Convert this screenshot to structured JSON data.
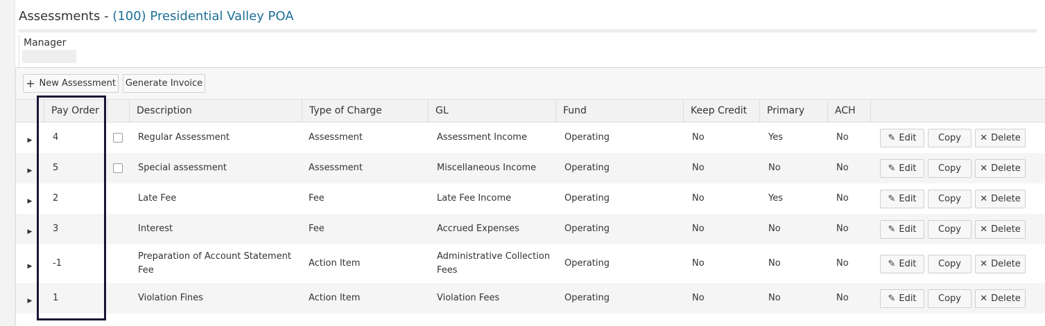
{
  "page": {
    "title_prefix": "Assessments - ",
    "association": "(100) Presidential Valley POA"
  },
  "manager": {
    "label": "Manager",
    "value": ""
  },
  "toolbar": {
    "new_assessment_label": "New Assessment",
    "generate_invoice_label": "Generate Invoice"
  },
  "table": {
    "columns": [
      "Pay Order",
      "Description",
      "Type of Charge",
      "GL",
      "Fund",
      "Keep Credit",
      "Primary",
      "ACH"
    ],
    "rows": [
      {
        "pay_order": "4",
        "has_checkbox": true,
        "description": "Regular Assessment",
        "type": "Assessment",
        "gl": "Assessment Income",
        "fund": "Operating",
        "keep_credit": "No",
        "primary": "Yes",
        "ach": "No"
      },
      {
        "pay_order": "5",
        "has_checkbox": true,
        "description": "Special assessment",
        "type": "Assessment",
        "gl": "Miscellaneous Income",
        "fund": "Operating",
        "keep_credit": "No",
        "primary": "No",
        "ach": "No"
      },
      {
        "pay_order": "2",
        "has_checkbox": false,
        "description": "Late Fee",
        "type": "Fee",
        "gl": "Late Fee Income",
        "fund": "Operating",
        "keep_credit": "No",
        "primary": "Yes",
        "ach": "No"
      },
      {
        "pay_order": "3",
        "has_checkbox": false,
        "description": "Interest",
        "type": "Fee",
        "gl": "Accrued Expenses",
        "fund": "Operating",
        "keep_credit": "No",
        "primary": "No",
        "ach": "No"
      },
      {
        "pay_order": "-1",
        "has_checkbox": false,
        "description": "Preparation of Account Statement Fee",
        "type": "Action Item",
        "gl": "Administrative Collection Fees",
        "fund": "Operating",
        "keep_credit": "No",
        "primary": "No",
        "ach": "No"
      },
      {
        "pay_order": "1",
        "has_checkbox": false,
        "description": "Violation Fines",
        "type": "Action Item",
        "gl": "Violation Fees",
        "fund": "Operating",
        "keep_credit": "No",
        "primary": "No",
        "ach": "No"
      }
    ],
    "actions": {
      "edit": "Edit",
      "copy": "Copy",
      "delete": "Delete"
    }
  },
  "icons": {
    "new": "plus-icon",
    "edit": "pencil-icon",
    "delete": "x-icon",
    "expand": "triangle-right-icon"
  },
  "colors": {
    "association_link": "#1b6f96",
    "highlight_box": "#191636",
    "alt_row": "#f5f5f5"
  }
}
